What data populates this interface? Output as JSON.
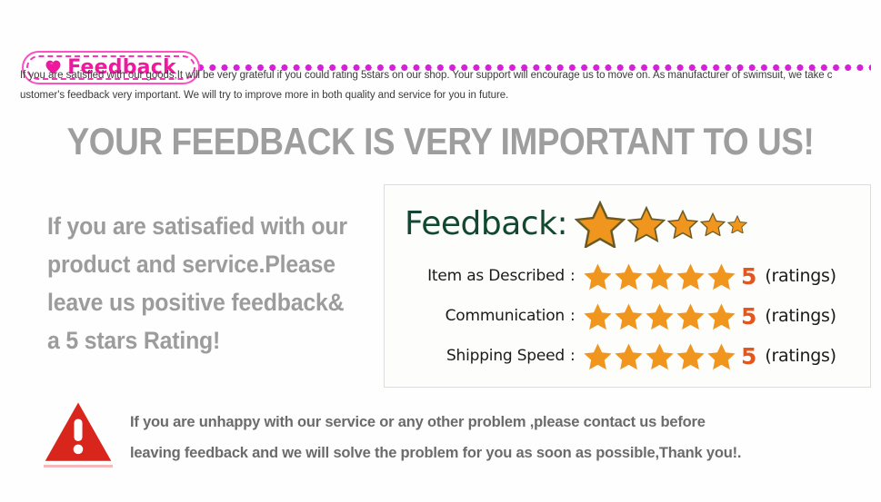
{
  "badge": {
    "label": "Feedback",
    "icon": "heart-icon",
    "border_color": "#ff4fc4",
    "text_color": "#f0189e"
  },
  "divider": {
    "style": "dotted",
    "color": "#d622d6"
  },
  "intro": {
    "line1": "If you are satisfied with our goods,It will be very grateful if you could rating 5stars on our shop. Your support will encourage us to move on. As manufacturer of swimsuit, we take c",
    "line2": "ustomer's feedback very important. We will try to improve more in both quality and service for you in future."
  },
  "headline": {
    "text": "YOUR FEEDBACK IS VERY IMPORTANT TO US!",
    "color": "#9e9e9e"
  },
  "promo": {
    "line1": "If you are satisafied with  our",
    "line2": "product and service.Please",
    "line3": "leave us positive  feedback&",
    "line4": "a 5 stars Rating!",
    "color": "#9c9c9c"
  },
  "feedback_box": {
    "title": "Feedback:",
    "title_color": "#12482f",
    "decorative_star_count": 5,
    "star_color": "#f0961e",
    "score_color": "#e2571e",
    "rows": [
      {
        "label": "Item as Described",
        "colon": ":",
        "stars": 5,
        "score": "5",
        "unit": "(ratings)"
      },
      {
        "label": "Communication",
        "colon": ":",
        "stars": 5,
        "score": "5",
        "unit": "(ratings)"
      },
      {
        "label": "Shipping Speed",
        "colon": ":",
        "stars": 5,
        "score": "5",
        "unit": "(ratings)"
      }
    ]
  },
  "warning": {
    "icon": "warning-triangle-icon",
    "icon_color": "#d9261c",
    "line1": "If you are unhappy with our service or any other problem ,please contact us before",
    "line2": "leaving feedback and we will solve the problem for you as soon as possible,Thank you!.",
    "color": "#6b6b6b"
  }
}
